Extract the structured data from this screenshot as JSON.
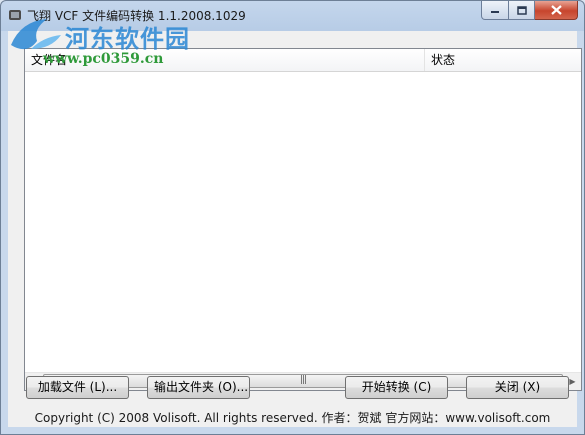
{
  "window": {
    "title": "飞翔 VCF 文件编码转换  1.1.2008.1029"
  },
  "watermark": {
    "site_name": "河东软件园",
    "url": "www.pc0359.cn"
  },
  "listview": {
    "columns": [
      "文件名",
      "状态"
    ],
    "rows": [],
    "scroll_grip": "|||"
  },
  "buttons": {
    "load_files": "加载文件 (L)...",
    "output_folder": "输出文件夹 (O)...",
    "start_convert": "开始转换 (C)",
    "close": "关闭 (X)"
  },
  "footer": {
    "copyright": "Copyright (C) 2008 Volisoft. All rights reserved.  作者：贺斌   官方网站：www.volisoft.com"
  }
}
